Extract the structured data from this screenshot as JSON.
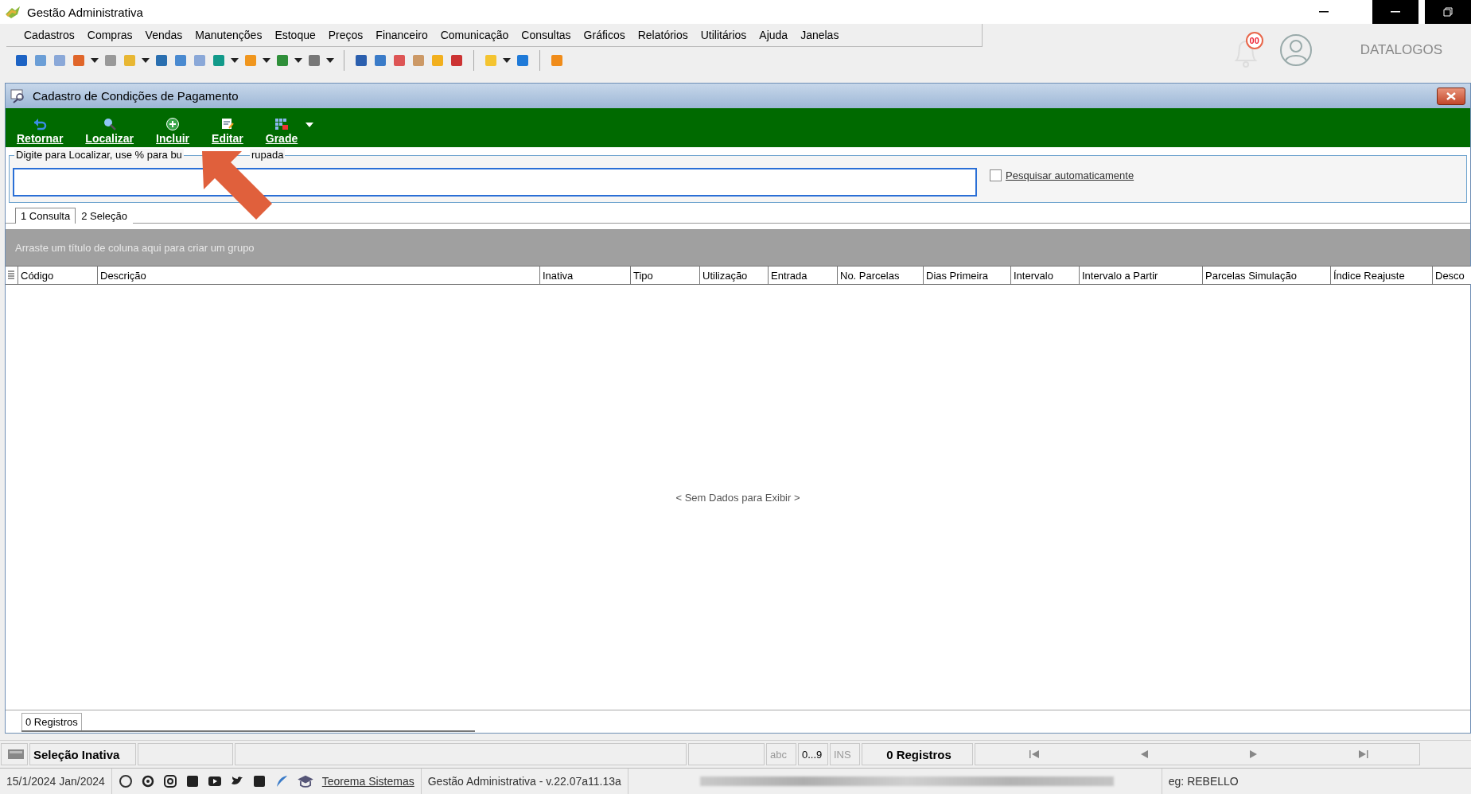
{
  "app_title": "Gestão Administrativa",
  "menu": [
    "Cadastros",
    "Compras",
    "Vendas",
    "Manutenções",
    "Estoque",
    "Preços",
    "Financeiro",
    "Comunicação",
    "Consultas",
    "Gráficos",
    "Relatórios",
    "Utilitários",
    "Ajuda",
    "Janelas"
  ],
  "notifications": {
    "badge": "00"
  },
  "brand": "DATALOGOS",
  "child_window": {
    "title": "Cadastro de Condições de Pagamento"
  },
  "actions": [
    {
      "label": "Retornar",
      "kind": "back"
    },
    {
      "label": "Localizar",
      "kind": "search"
    },
    {
      "label": "Incluir",
      "kind": "add"
    },
    {
      "label": "Editar",
      "kind": "edit"
    },
    {
      "label": "Grade",
      "kind": "grid"
    }
  ],
  "search": {
    "label": "Digite para Localizar, use % para bu",
    "label_tail": "rupada",
    "auto_search": {
      "label": "Pesquisar automaticamente",
      "checked": false
    }
  },
  "tabs": [
    {
      "label": "1 Consulta",
      "selected": true
    },
    {
      "label": "2 Seleção",
      "selected": false
    }
  ],
  "group_panel": "Arraste um título de coluna aqui para criar um grupo",
  "table": {
    "columns": [
      "Código",
      "Descrição",
      "Inativa",
      "Tipo",
      "Utilização",
      "Entrada",
      "No. Parcelas",
      "Dias Primeira",
      "Intervalo",
      "Intervalo a Partir",
      "Parcelas Simulação",
      "Índice Reajuste",
      "Desco"
    ],
    "empty": "< Sem Dados para Exibir >"
  },
  "footer_count": "0 Registros",
  "status_bar": {
    "selection": "Seleção Inativa",
    "abc": "abc",
    "digits": "0...9",
    "ins": "INS",
    "records": "0 Registros"
  },
  "bottom_bar": {
    "date": "15/1/2024 Jan/2024",
    "company_link": "Teorema Sistemas",
    "version": "Gestão Administrativa - v.22.07a11.13a",
    "user": "eg: REBELLO"
  }
}
